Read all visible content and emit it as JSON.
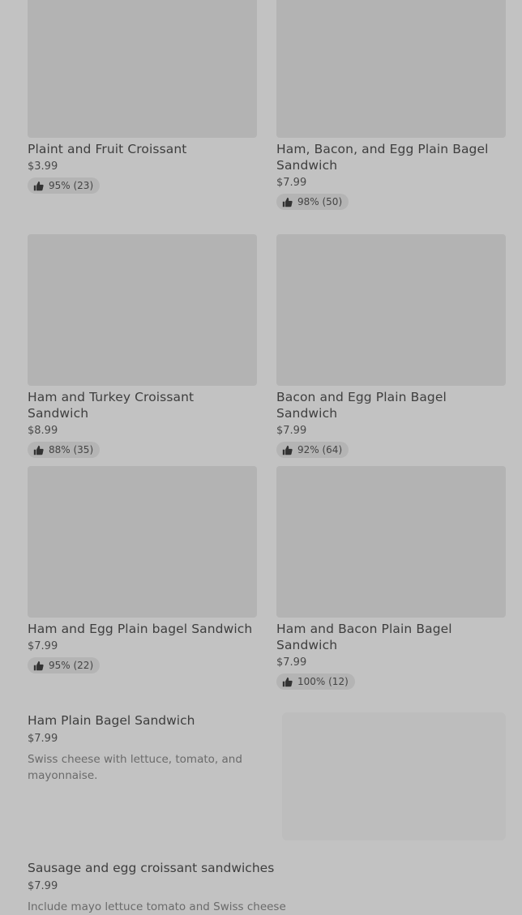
{
  "products": [
    {
      "title": "Plaint and Fruit Croissant",
      "price": "$3.99",
      "rating": "95% (23)"
    },
    {
      "title": "Ham, Bacon, and Egg Plain Bagel Sandwich",
      "price": "$7.99",
      "rating": "98% (50)"
    },
    {
      "title": "Ham and Turkey Croissant Sandwich",
      "price": "$8.99",
      "rating": "88% (35)"
    },
    {
      "title": "Bacon and Egg Plain Bagel Sandwich",
      "price": "$7.99",
      "rating": "92% (64)"
    },
    {
      "title": "Ham and Egg Plain bagel Sandwich",
      "price": "$7.99",
      "rating": "95% (22)"
    },
    {
      "title": "Ham and Bacon Plain Bagel Sandwich",
      "price": "$7.99",
      "rating": "100% (12)"
    }
  ],
  "list_items": [
    {
      "title": "Ham Plain Bagel Sandwich",
      "price": "$7.99",
      "description": "Swiss cheese with lettuce, tomato, and mayonnaise."
    },
    {
      "title": "Sausage and egg croissant sandwiches",
      "price": "$7.99",
      "description": "Include mayo lettuce tomato and Swiss cheese"
    }
  ],
  "icons": {
    "rating": "thumbs-up-icon"
  }
}
